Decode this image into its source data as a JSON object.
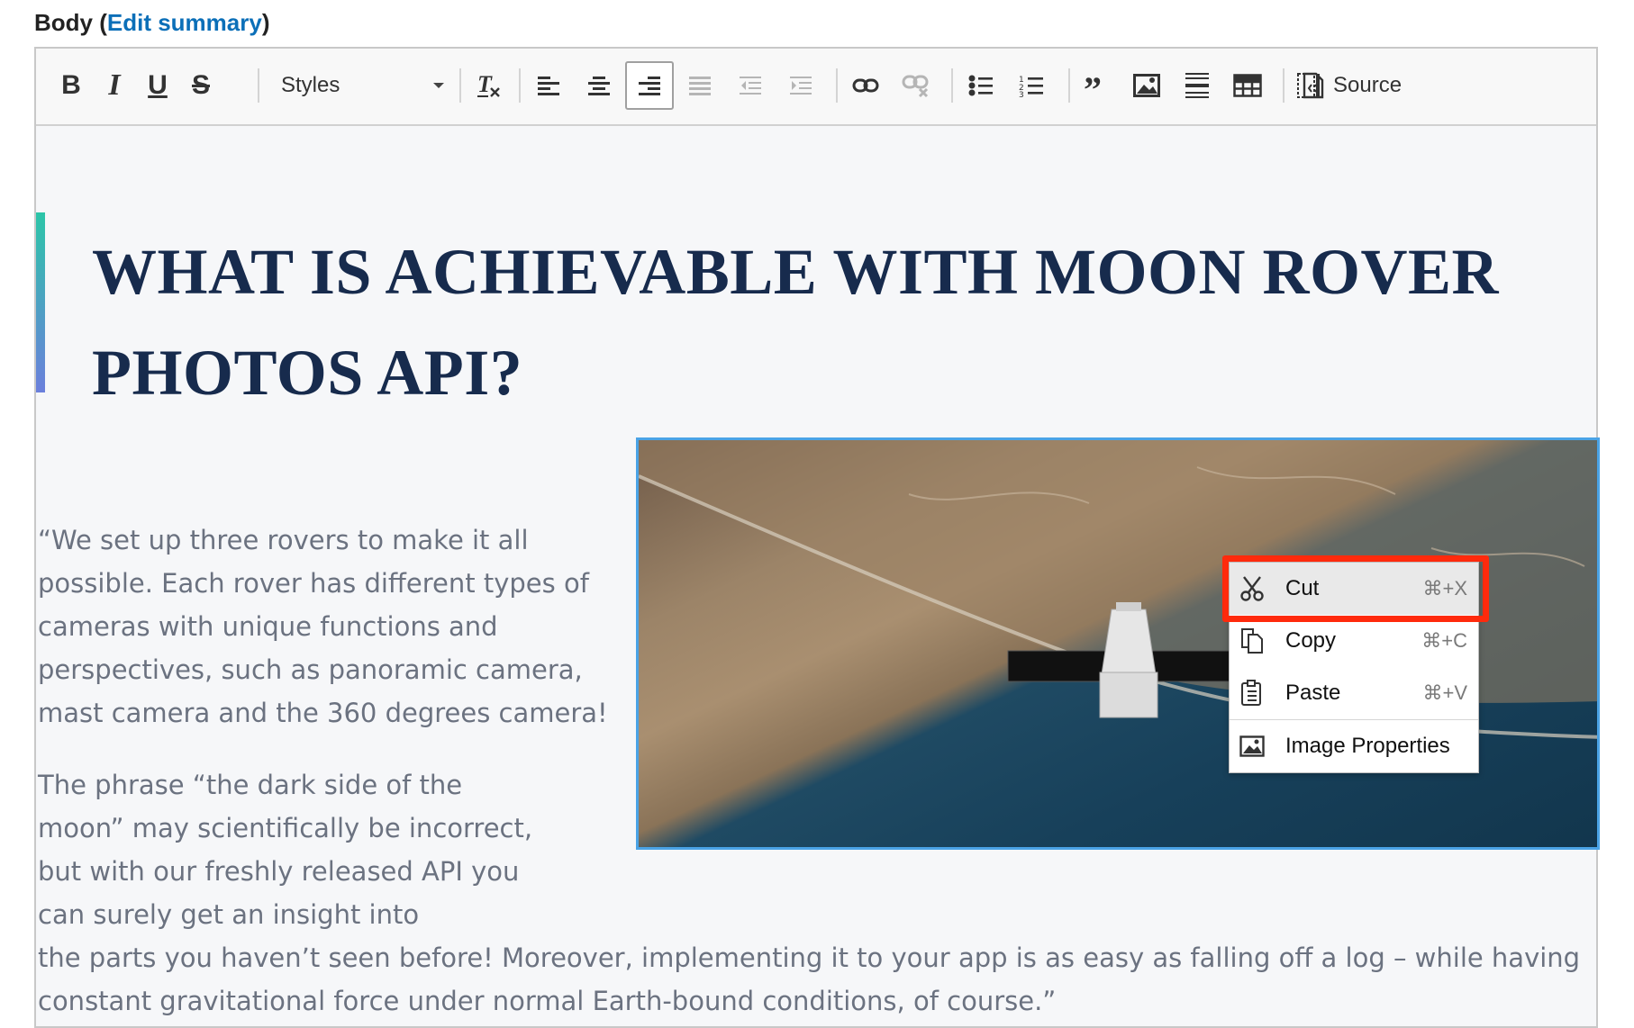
{
  "field": {
    "label": "Body",
    "link_text": "Edit summary"
  },
  "toolbar": {
    "styles_label": "Styles",
    "source_label": "Source",
    "buttons": [
      "bold-icon",
      "italic-icon",
      "underline-icon",
      "strikethrough-icon",
      "remove-format-icon",
      "align-left-icon",
      "align-center-icon",
      "align-right-icon",
      "justify-icon",
      "outdent-icon",
      "indent-icon",
      "link-icon",
      "unlink-icon",
      "bulleted-list-icon",
      "numbered-list-icon",
      "blockquote-icon",
      "image-icon",
      "horizontal-rule-icon",
      "table-icon",
      "show-blocks-icon",
      "source-icon"
    ],
    "active_button": "align-right",
    "letters": {
      "bold": "B",
      "italic": "I",
      "underline": "U",
      "strike": "S"
    }
  },
  "content": {
    "heading": "WHAT IS ACHIEVABLE WITH MOON ROVER PHOTOS API?",
    "paragraph_1": "“We set up three rovers to make it all possible. Each rover has different types of cameras with unique functions and perspectives, such as panoramic camera, mast camera and the 360 degrees camera!",
    "paragraph_2_part_1": "The phrase “the dark side of the moon” may scientifically be incorrect, but with our freshly released API you can surely get an insight into",
    "paragraph_2_part_2": "the parts you haven’t seen before! Moreover, implementing it to your app is as easy as falling off a log – while having constant gravitational force under normal Earth-bound conditions, of course.”"
  },
  "context_menu": {
    "items": [
      {
        "label": "Cut",
        "shortcut": "⌘+X",
        "icon": "scissors-icon"
      },
      {
        "label": "Copy",
        "shortcut": "⌘+C",
        "icon": "copy-icon"
      },
      {
        "label": "Paste",
        "shortcut": "⌘+V",
        "icon": "paste-icon"
      },
      {
        "label": "Image Properties",
        "shortcut": "",
        "icon": "image-icon"
      }
    ],
    "highlighted": "Cut"
  },
  "colors": {
    "heading": "#172b4d",
    "link": "#0b6fb8",
    "highlight_border": "#ff2a0c",
    "image_border": "#4aa3e6"
  }
}
